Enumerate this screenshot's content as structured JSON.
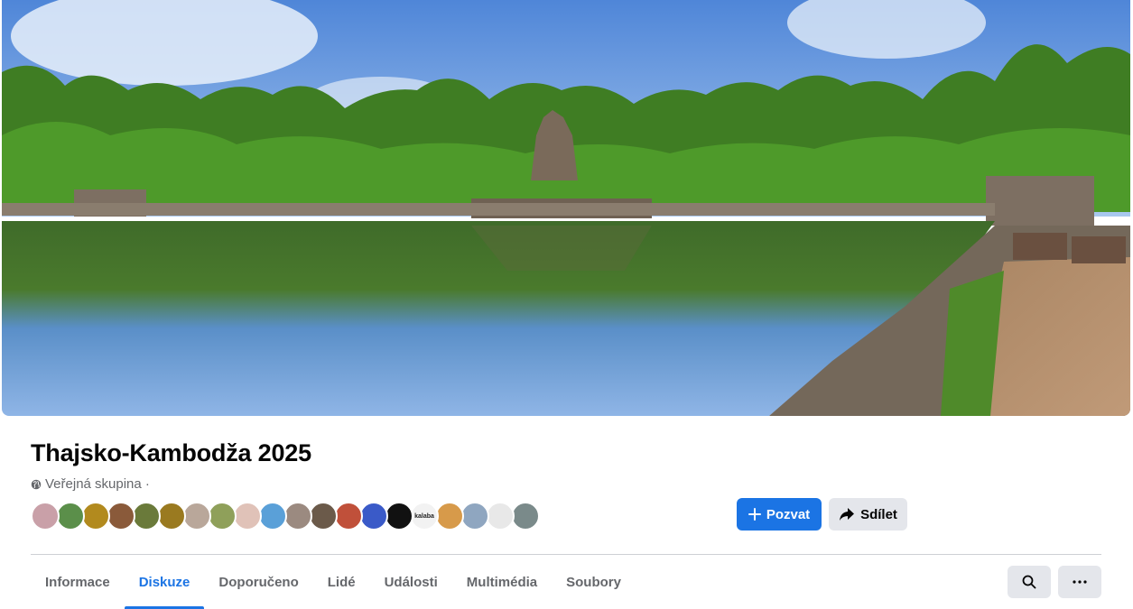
{
  "group": {
    "title": "Thajsko-Kambodža 2025",
    "privacy_label": "Veřejná skupina ·",
    "cover_alt": "Neak Pean temple pond panorama"
  },
  "members": {
    "avatars": [
      {
        "color": "#c9a0a8"
      },
      {
        "color": "#5b8f4a"
      },
      {
        "color": "#b28a1e"
      },
      {
        "color": "#8a5a3a"
      },
      {
        "color": "#6a7a3a"
      },
      {
        "color": "#9a7a20"
      },
      {
        "color": "#b9a79a"
      },
      {
        "color": "#8fa05a"
      },
      {
        "color": "#e0c2b8"
      },
      {
        "color": "#5aa0d8"
      },
      {
        "color": "#9b8a80"
      },
      {
        "color": "#6b5a4a"
      },
      {
        "color": "#c0503a"
      },
      {
        "color": "#3a5ac8"
      },
      {
        "color": "#111111"
      },
      {
        "color": "#f2f2f2",
        "label": "kalaba"
      },
      {
        "color": "#d79a4a"
      },
      {
        "color": "#8fa6c0"
      },
      {
        "color": "#e8e8e8"
      },
      {
        "color": "#7a8a8a"
      }
    ]
  },
  "actions": {
    "invite_label": "Pozvat",
    "invite_icon": "plus-icon",
    "share_label": "Sdílet",
    "share_icon": "share-arrow-icon"
  },
  "tabs": [
    {
      "label": "Informace",
      "active": false
    },
    {
      "label": "Diskuze",
      "active": true
    },
    {
      "label": "Doporučeno",
      "active": false
    },
    {
      "label": "Lidé",
      "active": false
    },
    {
      "label": "Události",
      "active": false
    },
    {
      "label": "Multimédia",
      "active": false
    },
    {
      "label": "Soubory",
      "active": false
    }
  ],
  "toolbar": {
    "search_icon": "search-icon",
    "more_icon": "more-icon"
  },
  "colors": {
    "accent": "#1b74e4",
    "secondary_button": "#e4e6eb",
    "muted_text": "#65676b"
  }
}
